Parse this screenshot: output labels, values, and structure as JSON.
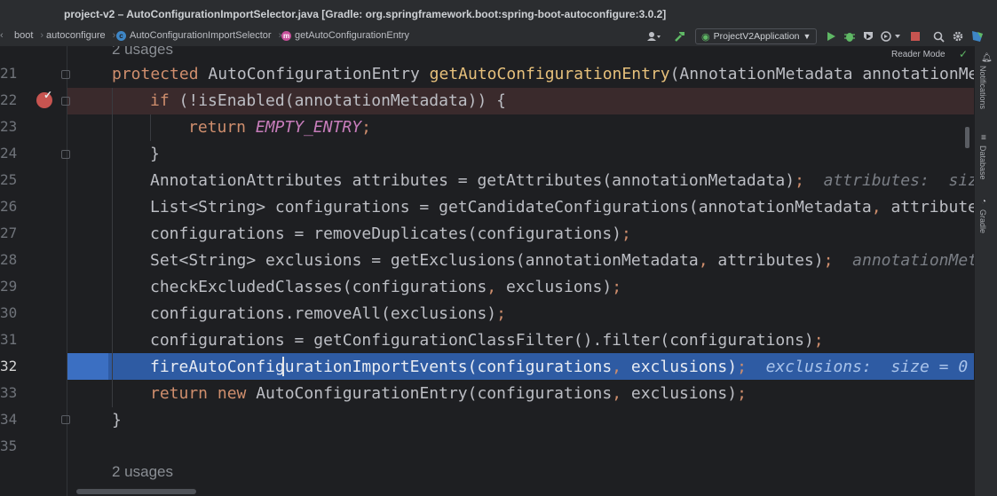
{
  "window": {
    "title": "project-v2 – AutoConfigurationImportSelector.java [Gradle: org.springframework.boot:spring-boot-autoconfigure:3.0.2]"
  },
  "breadcrumb": {
    "items": [
      "boot",
      "autoconfigure",
      "AutoConfigurationImportSelector",
      "getAutoConfigurationEntry"
    ]
  },
  "toolbar": {
    "run_config": "ProjectV2Application",
    "reader_mode": "Reader Mode"
  },
  "right_strip": {
    "labels": [
      "Notifications",
      "Database",
      "Gradle"
    ]
  },
  "editor": {
    "usages_top": "2 usages",
    "usages_bottom": "2 usages",
    "line_numbers": [
      "21",
      "22",
      "23",
      "24",
      "25",
      "26",
      "27",
      "28",
      "29",
      "30",
      "31",
      "32",
      "33",
      "34",
      "35"
    ],
    "current_line": "32",
    "lines": {
      "l21": {
        "kw": "protected",
        "type": "AutoConfigurationEntry",
        "method": "getAutoConfigurationEntry",
        "rest": "(AnnotationMetadata annotationMe"
      },
      "l22": {
        "kw": "if",
        "rest": " (!isEnabled(annotationMetadata)) {"
      },
      "l23": {
        "kw": "return",
        "const": "EMPTY_ENTRY",
        "semi": ";"
      },
      "l24": {
        "text": "}"
      },
      "l25": {
        "text": "AnnotationAttributes attributes = getAttributes(annotationMetadata)",
        "semi": ";",
        "hint": "attributes:  siz"
      },
      "l26": {
        "text": "List<String> configurations = getCandidateConfigurations(annotationMetadata",
        "comma": ",",
        "rest": " attribute"
      },
      "l27": {
        "text": "configurations = removeDuplicates(configurations)",
        "semi": ";"
      },
      "l28": {
        "text": "Set<String> exclusions = getExclusions(annotationMetadata",
        "comma": ",",
        "rest": " attributes)",
        "semi": ";",
        "hint": "annotationMet"
      },
      "l29": {
        "text": "checkExcludedClasses(configurations",
        "comma": ",",
        "rest": " exclusions)",
        "semi": ";"
      },
      "l30": {
        "text": "configurations.removeAll(exclusions)",
        "semi": ";"
      },
      "l31": {
        "text": "configurations = getConfigurationClassFilter().filter(configurations)",
        "semi": ";"
      },
      "l32": {
        "text": "fireAutoConfigurationImportEvents(configurations",
        "comma": ",",
        "rest": " exclusions)",
        "semi": ";",
        "hint": "exclusions:  size = 0"
      },
      "l33": {
        "kw": "return new",
        "text": " AutoConfigurationEntry(configurations",
        "comma": ",",
        "rest": " exclusions)",
        "semi": ";"
      },
      "l34": {
        "text": "}"
      }
    }
  },
  "colors": {
    "background": "#1e1f22",
    "keyword": "#cf8e6d",
    "method_decl": "#e6c07b",
    "constant": "#c77dbb",
    "selection": "#2e5ba3",
    "breakpoint_line": "#3a2a2c",
    "breakpoint": "#c75450"
  }
}
